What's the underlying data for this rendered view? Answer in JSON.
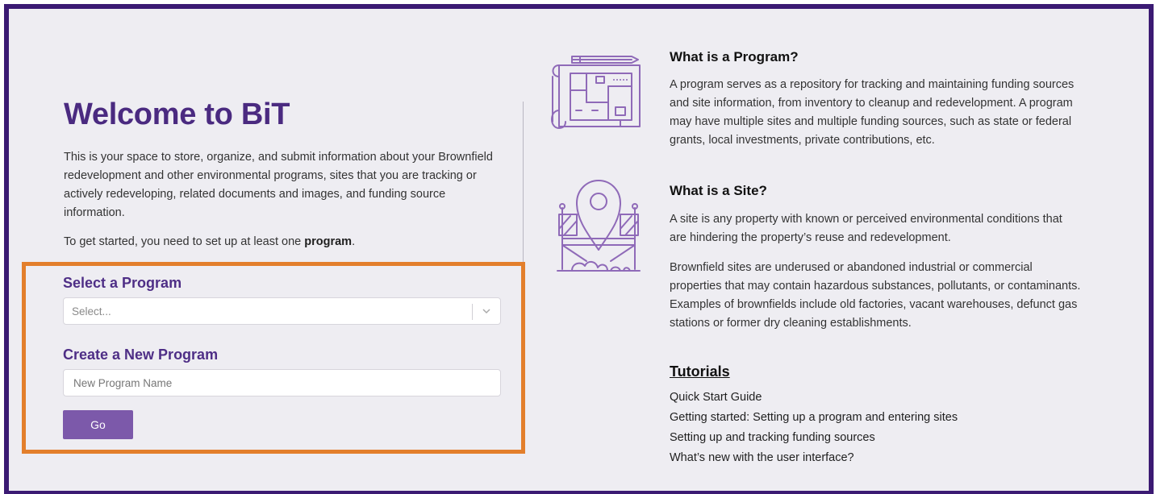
{
  "welcome": {
    "title": "Welcome to BiT",
    "intro": "This is your space to store, organize, and submit information about your Brownfield redevelopment and other environmental programs, sites that you are tracking or actively redeveloping, related documents and images, and funding source information.",
    "get_started_prefix": "To get started, you need to set up at least one ",
    "get_started_bold": "program",
    "get_started_suffix": "."
  },
  "select_program": {
    "label": "Select a Program",
    "placeholder": "Select..."
  },
  "create_program": {
    "label": "Create a New Program",
    "placeholder": "New Program Name",
    "button_label": "Go"
  },
  "info": {
    "program_title": "What is a Program?",
    "program_text": "A program serves as a repository for tracking and maintaining funding sources and site information, from inventory to cleanup and redevelopment. A program may have multiple sites and multiple funding sources, such as state or federal grants, local investments, private contributions, etc.",
    "site_title": "What is a Site?",
    "site_text_1": "A site is any property with known or perceived environmental conditions that are hindering the property’s reuse and redevelopment.",
    "site_text_2": "Brownfield sites are underused or abandoned industrial or commercial properties that may contain hazardous substances, pollutants, or contaminants. Examples of brownfields include old factories, vacant warehouses, defunct gas stations or former dry cleaning establishments."
  },
  "tutorials": {
    "title": "Tutorials",
    "items": [
      "Quick Start Guide",
      "Getting started: Setting up a program and entering sites",
      "Setting up and tracking funding sources",
      "What’s new with the user interface?"
    ]
  },
  "icons": {
    "blueprint": "blueprint-icon",
    "site": "site-location-icon",
    "chevron": "chevron-down-icon"
  },
  "colors": {
    "frame": "#3b1a73",
    "accent": "#4a2a80",
    "button": "#7c59aa",
    "highlight": "#e37f2c",
    "illustration": "#8f6ab8"
  }
}
